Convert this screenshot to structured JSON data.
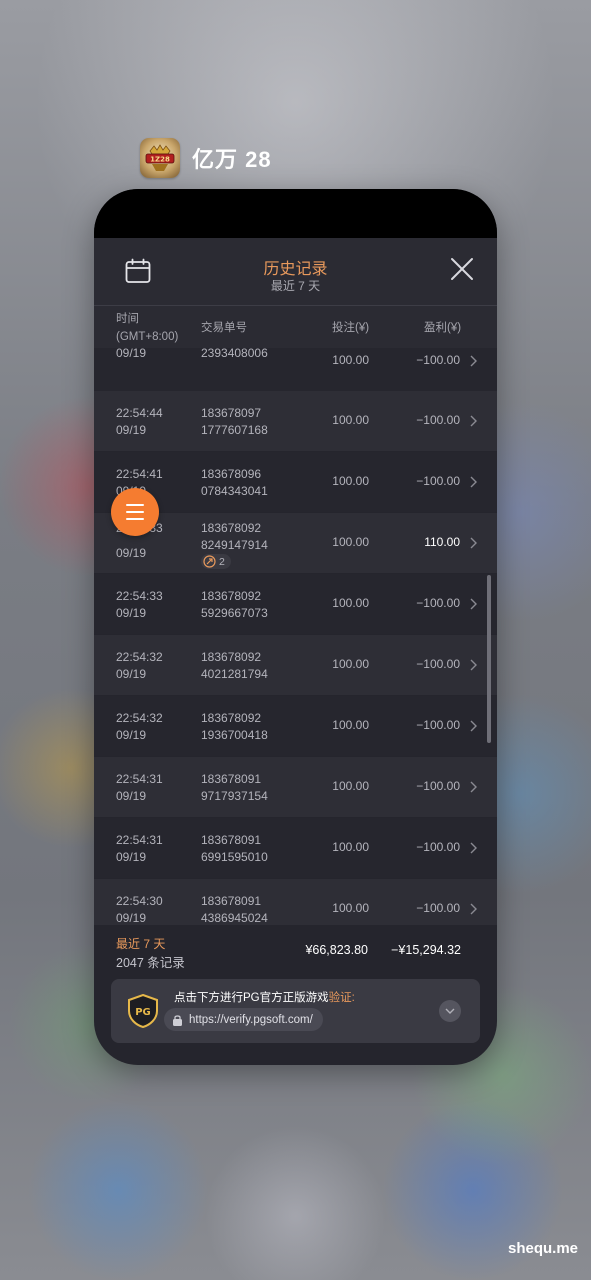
{
  "app": {
    "name": "亿万 28"
  },
  "header": {
    "title": "历史记录",
    "subtitle": "最近 7 天"
  },
  "columns": {
    "time": "时间",
    "timezone": "(GMT+8:00)",
    "order": "交易单号",
    "bet": "投注(¥)",
    "profit": "盈利(¥)"
  },
  "rows": [
    {
      "time": "",
      "date": "09/19",
      "order1": "",
      "order2": "2393408006",
      "bet": "100.00",
      "profit": "−100.00",
      "win": false
    },
    {
      "time": "22:54:44",
      "date": "09/19",
      "order1": "183678097",
      "order2": "1777607168",
      "bet": "100.00",
      "profit": "−100.00",
      "win": false
    },
    {
      "time": "22:54:41",
      "date": "09/19",
      "order1": "183678096",
      "order2": "0784343041",
      "bet": "100.00",
      "profit": "−100.00",
      "win": false
    },
    {
      "time": "22:54:33",
      "date": "09/19",
      "order1": "183678092",
      "order2": "8249147914",
      "bet": "100.00",
      "profit": "110.00",
      "win": true,
      "badge": "2"
    },
    {
      "time": "22:54:33",
      "date": "09/19",
      "order1": "183678092",
      "order2": "5929667073",
      "bet": "100.00",
      "profit": "−100.00",
      "win": false
    },
    {
      "time": "22:54:32",
      "date": "09/19",
      "order1": "183678092",
      "order2": "4021281794",
      "bet": "100.00",
      "profit": "−100.00",
      "win": false
    },
    {
      "time": "22:54:32",
      "date": "09/19",
      "order1": "183678092",
      "order2": "1936700418",
      "bet": "100.00",
      "profit": "−100.00",
      "win": false
    },
    {
      "time": "22:54:31",
      "date": "09/19",
      "order1": "183678091",
      "order2": "9717937154",
      "bet": "100.00",
      "profit": "−100.00",
      "win": false
    },
    {
      "time": "22:54:31",
      "date": "09/19",
      "order1": "183678091",
      "order2": "6991595010",
      "bet": "100.00",
      "profit": "−100.00",
      "win": false
    },
    {
      "time": "22:54:30",
      "date": "09/19",
      "order1": "183678091",
      "order2": "4386945024",
      "bet": "100.00",
      "profit": "−100.00",
      "win": false
    }
  ],
  "summary": {
    "period": "最近 7 天",
    "count": "2047 条记录",
    "total_bet": "¥66,823.80",
    "total_profit": "−¥15,294.32"
  },
  "verify": {
    "text": "点击下方进行PG官方正版游戏",
    "highlight": "验证:",
    "url": "https://verify.pgsoft.com/"
  },
  "watermark": "shequ.me",
  "colors": {
    "accent": "#e8995c",
    "fab": "#f57c30",
    "panel": "#25252d"
  },
  "icons": [
    "calendar-icon",
    "close-icon",
    "menu-icon",
    "chevron-right-icon",
    "multiplier-icon",
    "pg-shield-icon",
    "lock-icon",
    "chevron-down-icon"
  ]
}
